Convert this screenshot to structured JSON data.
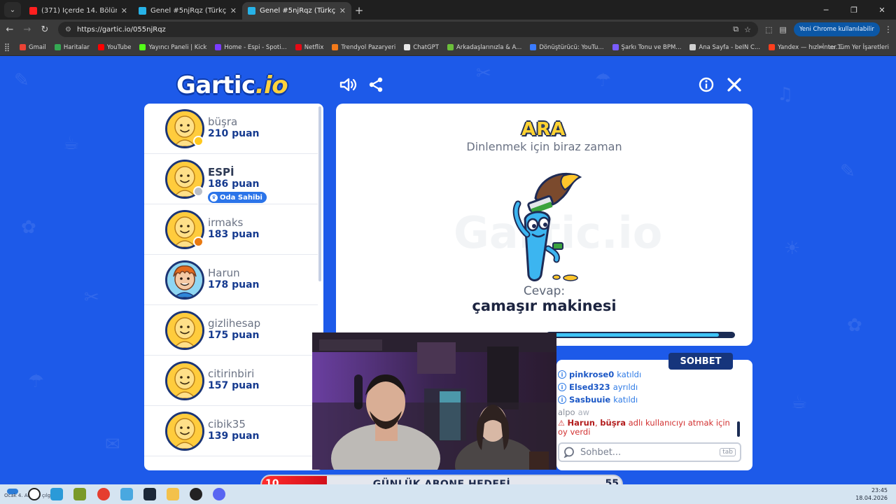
{
  "browser": {
    "tabs": [
      {
        "title": "(371) İçerde 14. Bölüm (Full HD)",
        "favicon_color": "#ff1f1f",
        "active": false
      },
      {
        "title": "Genel #5njRqz (Türkçe) - Gartic",
        "favicon_color": "#27b3e8",
        "active": false
      },
      {
        "title": "Genel #5njRqz (Türkçe) - Gartic",
        "favicon_color": "#27b3e8",
        "active": true
      }
    ],
    "url": "https://gartic.io/055njRqz",
    "chrome_pill": "Yeni Chrome kullanılabilir",
    "bookmarks": [
      {
        "label": "Gmail",
        "color": "#ea4335"
      },
      {
        "label": "Haritalar",
        "color": "#34a853"
      },
      {
        "label": "YouTube",
        "color": "#ff0000"
      },
      {
        "label": "Yayıncı Paneli | Kick",
        "color": "#53fc18"
      },
      {
        "label": "Home - Espi - Spoti...",
        "color": "#7a3cff"
      },
      {
        "label": "Netflix",
        "color": "#e50914"
      },
      {
        "label": "Trendyol Pazaryeri",
        "color": "#f27a1a"
      },
      {
        "label": "ChatGPT",
        "color": "#e8e8e8"
      },
      {
        "label": "Arkadaşlarınızla & A...",
        "color": "#6bbf3a"
      },
      {
        "label": "Dönüştürücü: YouTu...",
        "color": "#3a7bff"
      },
      {
        "label": "Şarkı Tonu ve BPM...",
        "color": "#7a5cff"
      },
      {
        "label": "Ana Sayfa - beIN C...",
        "color": "#cfcfcf"
      },
      {
        "label": "Yandex — hızlı İnter...",
        "color": "#fc3f1d"
      }
    ],
    "bookmarks_all": "Tüm Yer İşaretleri"
  },
  "game": {
    "logo_main": "Gartic",
    "logo_suffix": ".io",
    "players": [
      {
        "name": "büşra",
        "score": "210 puan",
        "dot": "#ffc81e",
        "bold": false,
        "avatar": "default"
      },
      {
        "name": "ESPİ",
        "score": "186 puan",
        "dot": "#b9bec8",
        "bold": true,
        "owner": "Oda Sahibi",
        "avatar": "default"
      },
      {
        "name": "irmaks",
        "score": "183 puan",
        "dot": "#e97a12",
        "bold": false,
        "avatar": "default"
      },
      {
        "name": "Harun",
        "score": "178 puan",
        "dot": "",
        "bold": false,
        "avatar": "custom"
      },
      {
        "name": "gizlihesap",
        "score": "175 puan",
        "dot": "",
        "bold": false,
        "avatar": "default"
      },
      {
        "name": "citirinbiri",
        "score": "157 puan",
        "dot": "",
        "bold": false,
        "avatar": "default"
      },
      {
        "name": "cibik35",
        "score": "139 puan",
        "dot": "",
        "bold": false,
        "avatar": "default"
      }
    ],
    "phase": "ARA",
    "phase_subtitle": "Dinlenmek için biraz zaman",
    "watermark": "Gartic.io",
    "answer_label": "Cevap:",
    "answer": "çamaşır makinesi",
    "timer_fraction": 0.92
  },
  "chat": {
    "tab_label": "SOHBET",
    "messages": [
      {
        "type": "info",
        "user": "pinkrose0",
        "action": "katıldı"
      },
      {
        "type": "info",
        "user": "Elsed323",
        "action": "ayrıldı"
      },
      {
        "type": "info",
        "user": "Sasbuuie",
        "action": "katıldı"
      },
      {
        "type": "plain",
        "user": "alpo",
        "text": "aw"
      }
    ],
    "warning": {
      "user1": "Harun",
      "sep": ", ",
      "user2": "büşra",
      "text": " adlı kullanıcıyı atmak için oy verdi"
    },
    "input_placeholder": "Sohbet...",
    "tab_key": "tab"
  },
  "sub_goal": {
    "current": "10",
    "title": "GÜNLÜK ABONE HEDEFİ",
    "target": "55",
    "fraction": 0.18
  },
  "taskbar": {
    "weather": "Ocak 4. Alaska çılgınlığı",
    "time": "23:45",
    "date": "18.04.2026"
  }
}
